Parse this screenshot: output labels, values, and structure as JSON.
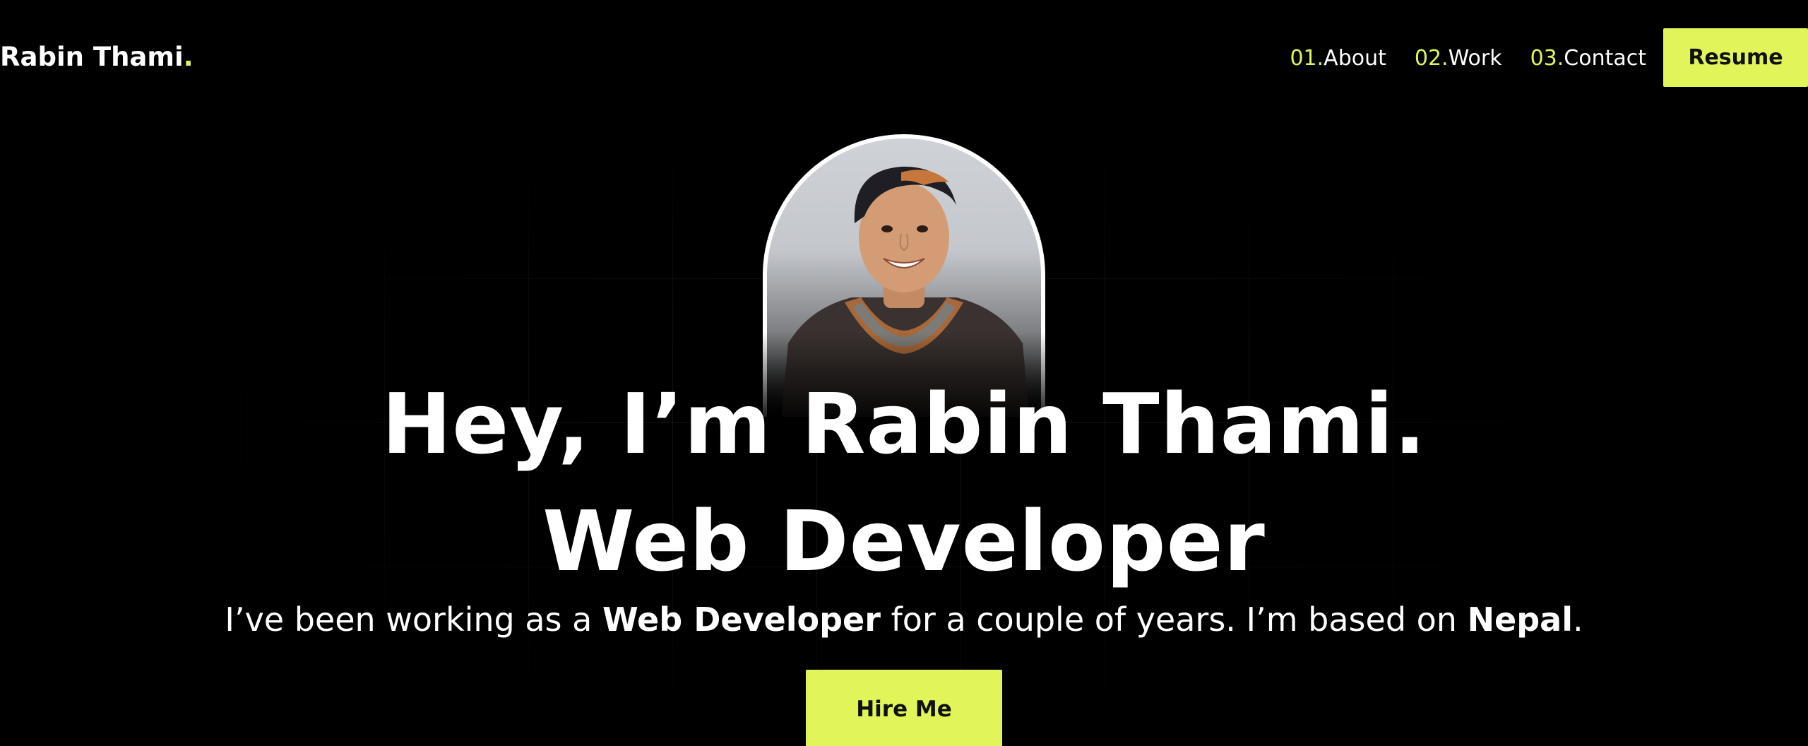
{
  "header": {
    "logo_text": "Rabin Thami",
    "logo_dot": ".",
    "nav": [
      {
        "num": "01.",
        "label": "About"
      },
      {
        "num": "02.",
        "label": "Work"
      },
      {
        "num": "03.",
        "label": "Contact"
      }
    ],
    "resume_label": "Resume"
  },
  "hero": {
    "headline_1": "Hey, I’m Rabin Thami.",
    "headline_2": "Web Developer",
    "intro": {
      "part1": "I’ve been working as a ",
      "role": "Web Developer",
      "part2": " for a couple of years. I’m based on ",
      "location": "Nepal",
      "part3": "."
    },
    "cta_label": "Hire Me"
  },
  "colors": {
    "background": "#000000",
    "accent": "#e1f55a",
    "text": "#ffffff",
    "button_text": "#111111"
  }
}
